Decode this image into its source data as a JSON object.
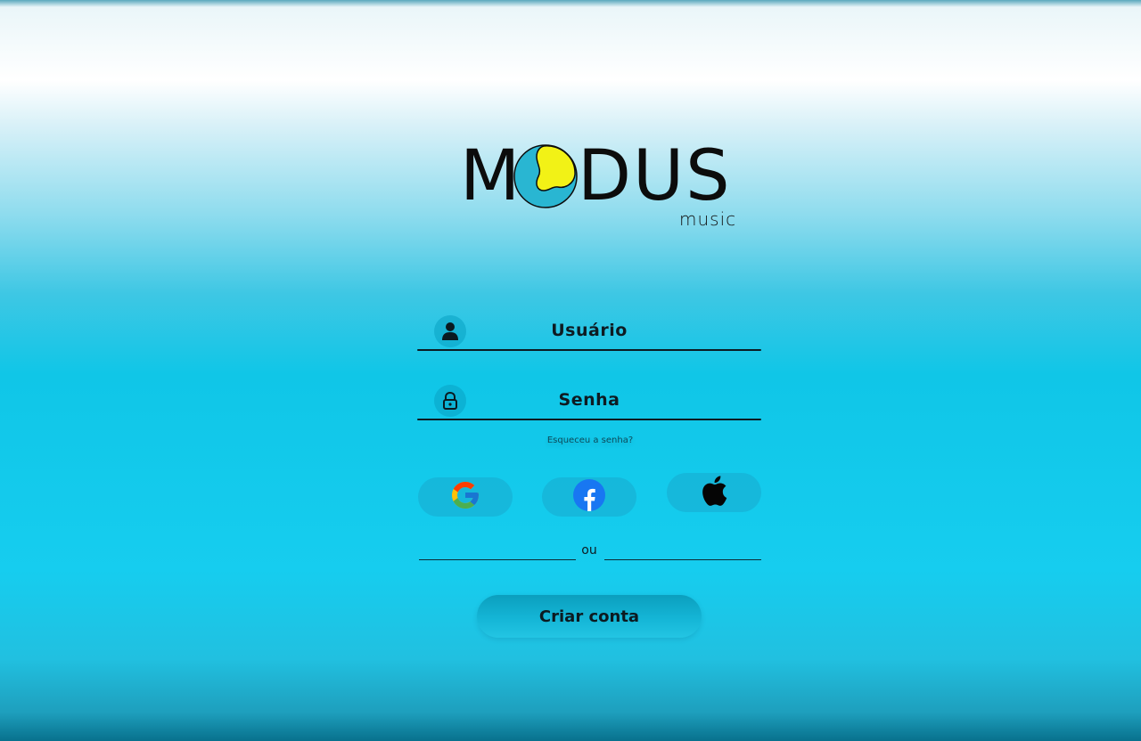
{
  "brand": {
    "name_prefix": "M",
    "name_suffix": "DUS",
    "subtitle": "music"
  },
  "login": {
    "username_placeholder": "Usuário",
    "password_placeholder": "Senha",
    "forgot_password": "Esqueceu a senha?"
  },
  "social": {
    "google_icon": "google-icon",
    "facebook_icon": "facebook-icon",
    "apple_icon": "apple-icon"
  },
  "divider": {
    "text": "ou"
  },
  "actions": {
    "create_account": "Criar conta"
  },
  "colors": {
    "accent": "#16cdef",
    "logo_blue": "#29b6d2",
    "logo_yellow": "#f2f216"
  }
}
